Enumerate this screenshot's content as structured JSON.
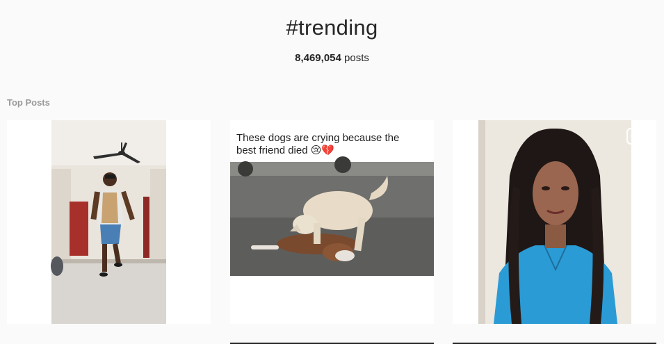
{
  "header": {
    "hashtag": "#trending",
    "post_count": "8,469,054",
    "post_count_suffix": " posts"
  },
  "sections": {
    "top_posts_label": "Top Posts"
  },
  "posts": [
    {
      "type": "video",
      "icon": "video-camera-icon",
      "image": "man-walking-in-room-photo"
    },
    {
      "type": "video",
      "icon": "video-camera-icon",
      "image": "two-dogs-on-road-photo",
      "caption_line1": "These dogs are crying because the",
      "caption_line2": "best friend died 😢💔"
    },
    {
      "type": "video",
      "icon": "video-camera-icon",
      "image": "woman-portrait-photo"
    }
  ],
  "colors": {
    "background": "#fafafa",
    "text": "#262626",
    "muted": "#999999"
  }
}
